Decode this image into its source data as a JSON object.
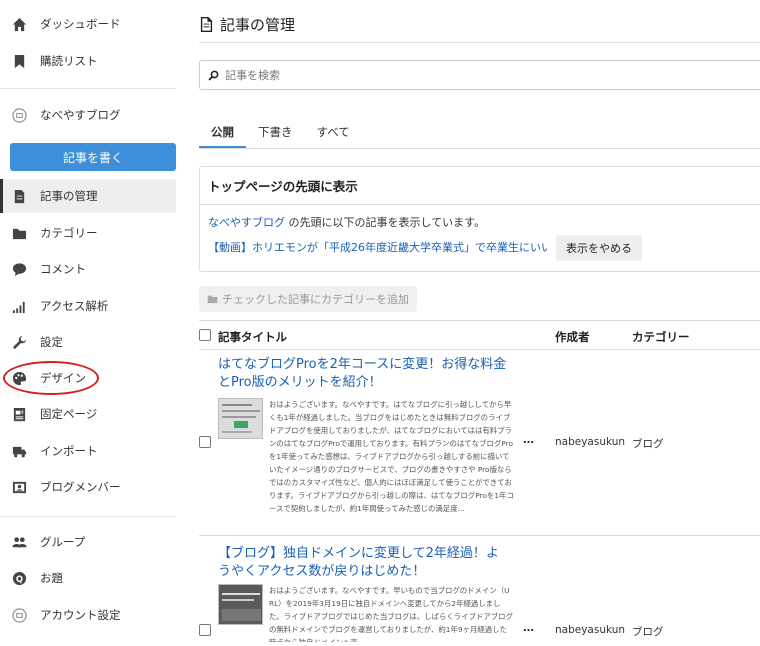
{
  "sidebar": {
    "items": [
      {
        "label": "ダッシュボード",
        "icon": "home-icon"
      },
      {
        "label": "購読リスト",
        "icon": "bookmark-icon"
      },
      {
        "label": "なべやすブログ",
        "icon": "blog-avatar-icon"
      },
      {
        "label": "記事の管理",
        "icon": "document-icon"
      },
      {
        "label": "カテゴリー",
        "icon": "folder-icon"
      },
      {
        "label": "コメント",
        "icon": "comment-icon"
      },
      {
        "label": "アクセス解析",
        "icon": "bar-chart-icon"
      },
      {
        "label": "設定",
        "icon": "wrench-icon"
      },
      {
        "label": "デザイン",
        "icon": "palette-icon"
      },
      {
        "label": "固定ページ",
        "icon": "page-icon"
      },
      {
        "label": "インポート",
        "icon": "truck-icon"
      },
      {
        "label": "ブログメンバー",
        "icon": "member-icon"
      },
      {
        "label": "グループ",
        "icon": "group-icon"
      },
      {
        "label": "お題",
        "icon": "topic-icon"
      },
      {
        "label": "アカウント設定",
        "icon": "account-icon"
      }
    ],
    "write_button": "記事を書く"
  },
  "main": {
    "title": "記事の管理",
    "search_placeholder": "記事を検索",
    "tabs": [
      "公開",
      "下書き",
      "すべて"
    ],
    "pin": {
      "heading": "トップページの先頭に表示",
      "blog_name": "なべやすブログ",
      "desc_suffix": " の先頭に以下の記事を表示しています。",
      "article": "【動画】ホリエモンが「平成26年度近畿大学卒業式」で卒業生にいい...",
      "stop_button": "表示をやめる"
    },
    "bulk_button": "チェックした記事にカテゴリーを追加",
    "table": {
      "headers": {
        "title": "記事タイトル",
        "author": "作成者",
        "category": "カテゴリー"
      },
      "rows": [
        {
          "title": "はてなブログProを2年コースに変更！お得な料金とPro版のメリットを紹介！",
          "excerpt": "おはようございます。なべやすです。はてなブログに引っ越ししてから早くも1年が経過しました。当ブログをはじめたときは無料ブログのライブドアブログを使用しておりましたが、はてなブログにおいてはは有料プランのはてなブログProで運用しております。有料プランのはてなブログProを1年使ってみた感想は、ライブドアブログから引っ越しする前に描いていたイメージ通りのブログサービスで、ブログの書きやすさや Pro版ならではのカスタマイズ性など、個人的にはほぼ満足して使うことができております。ライブドアブログから引っ越しの際は、はてなブログProを1年コースで契約しましたが、約1年間使ってみた感じの満足度...",
          "author": "nabeyasukun",
          "category": "ブログ",
          "actions": "…"
        },
        {
          "title": "【ブログ】独自ドメインに変更して2年経過！ようやくアクセス数が戻りはじめた！",
          "excerpt": "おはようございます。なべやすです。早いもので当ブログのドメイン（URL）を2019年3月19日に独自ドメインへ変更してから2年経過しました。ライブドアブログではじめた当ブログは、しばらくライブドアブログの無料ドメインでブログを運営しておりましたが、約1年9ヶ月経過した時点から独自ドメインへ変",
          "author": "nabeyasukun",
          "category": "ブログ",
          "actions": "…"
        }
      ]
    }
  },
  "colors": {
    "accent": "#3d8fd9",
    "link": "#1a5fb4",
    "highlight_circle": "#d42020"
  }
}
